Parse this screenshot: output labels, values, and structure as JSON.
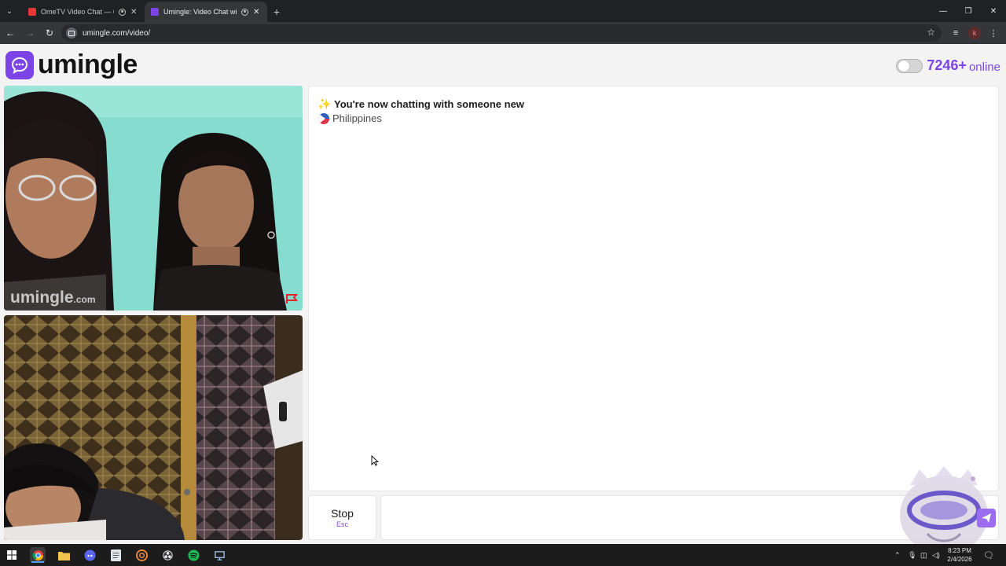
{
  "browser": {
    "tabs": [
      {
        "title": "OmeTV Video Chat — Ome",
        "active": false,
        "favicon_color": "#e53935"
      },
      {
        "title": "Umingle: Video Chat with S",
        "active": true,
        "favicon_color": "#7c44e6"
      }
    ],
    "new_tab_label": "+",
    "url": "umingle.com/video/",
    "profile_initial": "k"
  },
  "site": {
    "logo_text": "umingle",
    "brand_color": "#7c44e6",
    "online_count": "7246+",
    "online_label": "online"
  },
  "remote_video": {
    "watermark": "umingle",
    "watermark_suffix": ".com"
  },
  "chat": {
    "messages": [
      {
        "icon": "sparkles-icon",
        "text": "You're now chatting with someone new"
      },
      {
        "icon": "philippines-flag-icon",
        "text": "Philippines"
      }
    ]
  },
  "controls": {
    "stop_label": "Stop",
    "stop_shortcut": "Esc",
    "message_placeholder": ""
  },
  "taskbar": {
    "time": "8:23 PM",
    "date": "2/4/2026"
  }
}
